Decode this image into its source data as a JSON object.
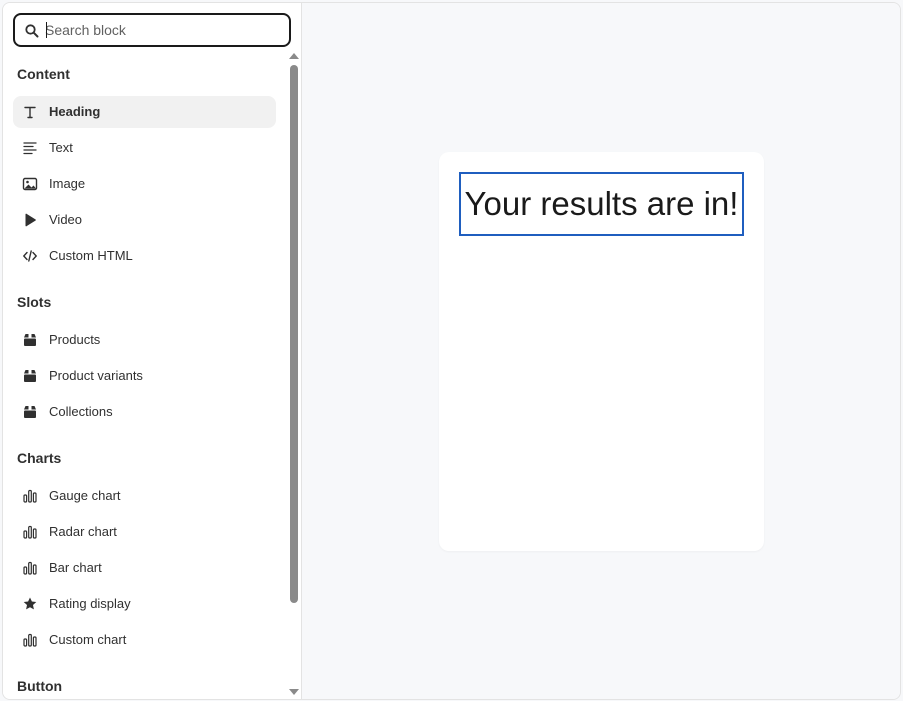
{
  "search": {
    "placeholder": "Search block",
    "value": ""
  },
  "sections": {
    "content": {
      "title": "Content",
      "items": [
        {
          "label": "Heading",
          "icon": "text-heading-icon",
          "active": true
        },
        {
          "label": "Text",
          "icon": "text-align-icon"
        },
        {
          "label": "Image",
          "icon": "image-icon"
        },
        {
          "label": "Video",
          "icon": "play-icon"
        },
        {
          "label": "Custom HTML",
          "icon": "code-icon"
        }
      ]
    },
    "slots": {
      "title": "Slots",
      "items": [
        {
          "label": "Products",
          "icon": "box-icon"
        },
        {
          "label": "Product variants",
          "icon": "box-icon"
        },
        {
          "label": "Collections",
          "icon": "box-icon"
        }
      ]
    },
    "charts": {
      "title": "Charts",
      "items": [
        {
          "label": "Gauge chart",
          "icon": "bar-chart-icon"
        },
        {
          "label": "Radar chart",
          "icon": "bar-chart-icon"
        },
        {
          "label": "Bar chart",
          "icon": "bar-chart-icon"
        },
        {
          "label": "Rating display",
          "icon": "star-icon"
        },
        {
          "label": "Custom chart",
          "icon": "bar-chart-icon"
        }
      ]
    },
    "button": {
      "title": "Button"
    }
  },
  "canvas": {
    "heading_text": "Your results are in!"
  },
  "colors": {
    "selection_border": "#1f5ebf",
    "active_item_bg": "#f1f1f1",
    "canvas_bg": "#f7f8fa"
  }
}
